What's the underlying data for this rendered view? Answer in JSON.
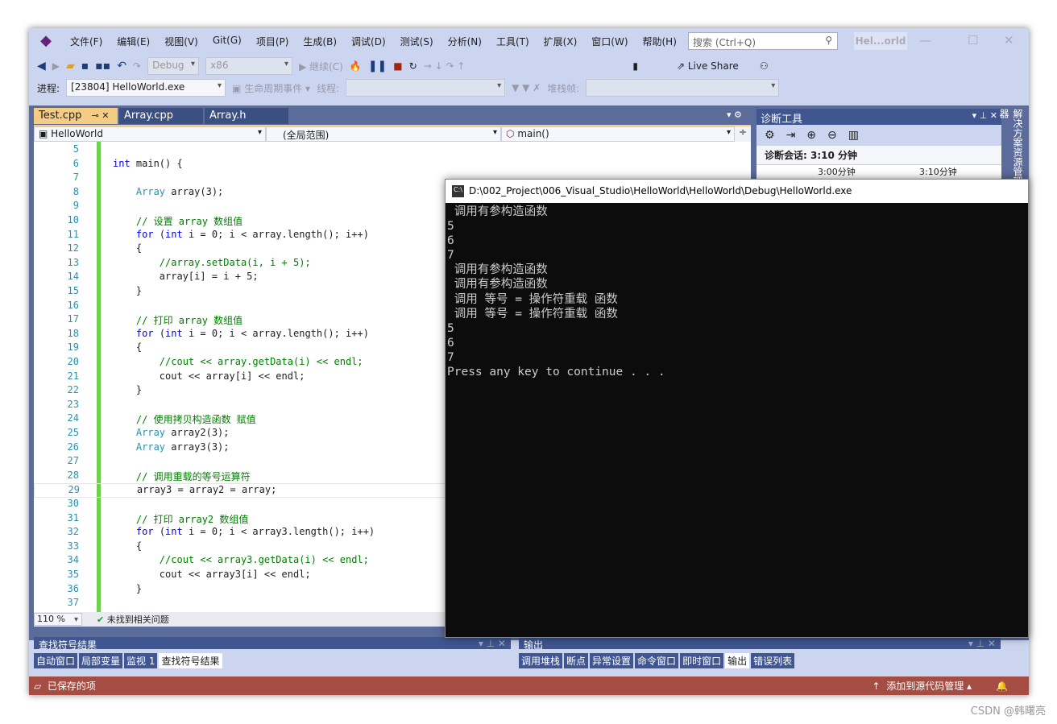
{
  "menu": [
    "文件(F)",
    "编辑(E)",
    "视图(V)",
    "Git(G)",
    "项目(P)",
    "生成(B)",
    "调试(D)",
    "测试(S)",
    "分析(N)",
    "工具(T)",
    "扩展(X)",
    "窗口(W)",
    "帮助(H)"
  ],
  "search_placeholder": "搜索 (Ctrl+Q)",
  "window_title": "Hel...orld",
  "toolbar": {
    "config": "Debug",
    "platform": "x86",
    "continue": "继续(C)",
    "live_share": "Live Share"
  },
  "debugbar": {
    "process_label": "进程:",
    "process": "[23804] HelloWorld.exe",
    "lifecycle": "生命周期事件",
    "thread_label": "线程:",
    "stack_label": "堆栈帧:"
  },
  "tabs": [
    "Test.cpp",
    "Array.cpp",
    "Array.h"
  ],
  "nav": {
    "project": "HelloWorld",
    "scope": "(全局范围)",
    "member": "main()"
  },
  "code": [
    {
      "n": "5",
      "t": ""
    },
    {
      "n": "6",
      "t": "int main() {"
    },
    {
      "n": "7",
      "t": ""
    },
    {
      "n": "8",
      "t": "    Array array(3);"
    },
    {
      "n": "9",
      "t": ""
    },
    {
      "n": "10",
      "t": "    // 设置 array 数组值"
    },
    {
      "n": "11",
      "t": "    for (int i = 0; i < array.length(); i++)"
    },
    {
      "n": "12",
      "t": "    {"
    },
    {
      "n": "13",
      "t": "        //array.setData(i, i + 5);"
    },
    {
      "n": "14",
      "t": "        array[i] = i + 5;"
    },
    {
      "n": "15",
      "t": "    }"
    },
    {
      "n": "16",
      "t": ""
    },
    {
      "n": "17",
      "t": "    // 打印 array 数组值"
    },
    {
      "n": "18",
      "t": "    for (int i = 0; i < array.length(); i++)"
    },
    {
      "n": "19",
      "t": "    {"
    },
    {
      "n": "20",
      "t": "        //cout << array.getData(i) << endl;"
    },
    {
      "n": "21",
      "t": "        cout << array[i] << endl;"
    },
    {
      "n": "22",
      "t": "    }"
    },
    {
      "n": "23",
      "t": ""
    },
    {
      "n": "24",
      "t": "    // 使用拷贝构造函数 赋值"
    },
    {
      "n": "25",
      "t": "    Array array2(3);"
    },
    {
      "n": "26",
      "t": "    Array array3(3);"
    },
    {
      "n": "27",
      "t": ""
    },
    {
      "n": "28",
      "t": "    // 调用重载的等号运算符"
    },
    {
      "n": "29",
      "t": "    array3 = array2 = array;"
    },
    {
      "n": "30",
      "t": ""
    },
    {
      "n": "31",
      "t": "    // 打印 array2 数组值"
    },
    {
      "n": "32",
      "t": "    for (int i = 0; i < array3.length(); i++)"
    },
    {
      "n": "33",
      "t": "    {"
    },
    {
      "n": "34",
      "t": "        //cout << array3.getData(i) << endl;"
    },
    {
      "n": "35",
      "t": "        cout << array3[i] << endl;"
    },
    {
      "n": "36",
      "t": "    }"
    },
    {
      "n": "37",
      "t": ""
    }
  ],
  "editor_status": {
    "zoom": "110 %",
    "issues": "未找到相关问题"
  },
  "diag": {
    "title": "诊断工具",
    "session": "诊断会话: 3:10 分钟",
    "t1": "3:00分钟",
    "t2": "3:10分钟"
  },
  "side_tab": "解决方案资源管理器",
  "console": {
    "title": "D:\\002_Project\\006_Visual_Studio\\HelloWorld\\HelloWorld\\Debug\\HelloWorld.exe",
    "output": " 调用有参构造函数\n5\n6\n7\n 调用有参构造函数\n 调用有参构造函数\n 调用 等号 = 操作符重载 函数\n 调用 等号 = 操作符重载 函数\n5\n6\n7\nPress any key to continue . . ."
  },
  "left_pane": {
    "title": "查找符号结果",
    "tabs": [
      "自动窗口",
      "局部变量",
      "监视 1",
      "查找符号结果"
    ]
  },
  "right_pane": {
    "title": "输出",
    "tabs": [
      "调用堆栈",
      "断点",
      "异常设置",
      "命令窗口",
      "即时窗口",
      "输出",
      "错误列表"
    ]
  },
  "statusbar": {
    "saved": "已保存的项",
    "source_control": "添加到源代码管理"
  },
  "watermark": "CSDN @韩曙亮"
}
